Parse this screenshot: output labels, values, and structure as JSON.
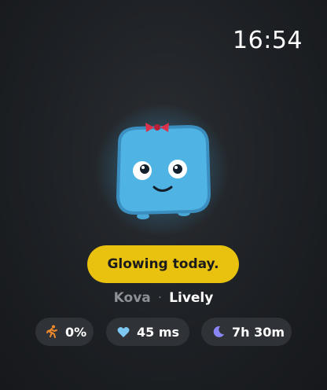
{
  "status_bar": {
    "time": "16:54"
  },
  "pet": {
    "message": "Glowing today.",
    "name": "Kova",
    "separator": "·",
    "mood": "Lively",
    "colors": {
      "body": "#4fb3e3",
      "body_outline": "#3b8fc0",
      "glow": "#3fa9e0",
      "bow": "#d9324a",
      "accent_pill": "#e9c20f"
    }
  },
  "stats": [
    {
      "icon": "running-person-icon",
      "value": "0%",
      "icon_color": "#f08a2b"
    },
    {
      "icon": "heart-icon",
      "value": "45 ms",
      "icon_color": "#7dc8f2"
    },
    {
      "icon": "moon-icon",
      "value": "7h 30m",
      "icon_color": "#8b86f5"
    }
  ]
}
